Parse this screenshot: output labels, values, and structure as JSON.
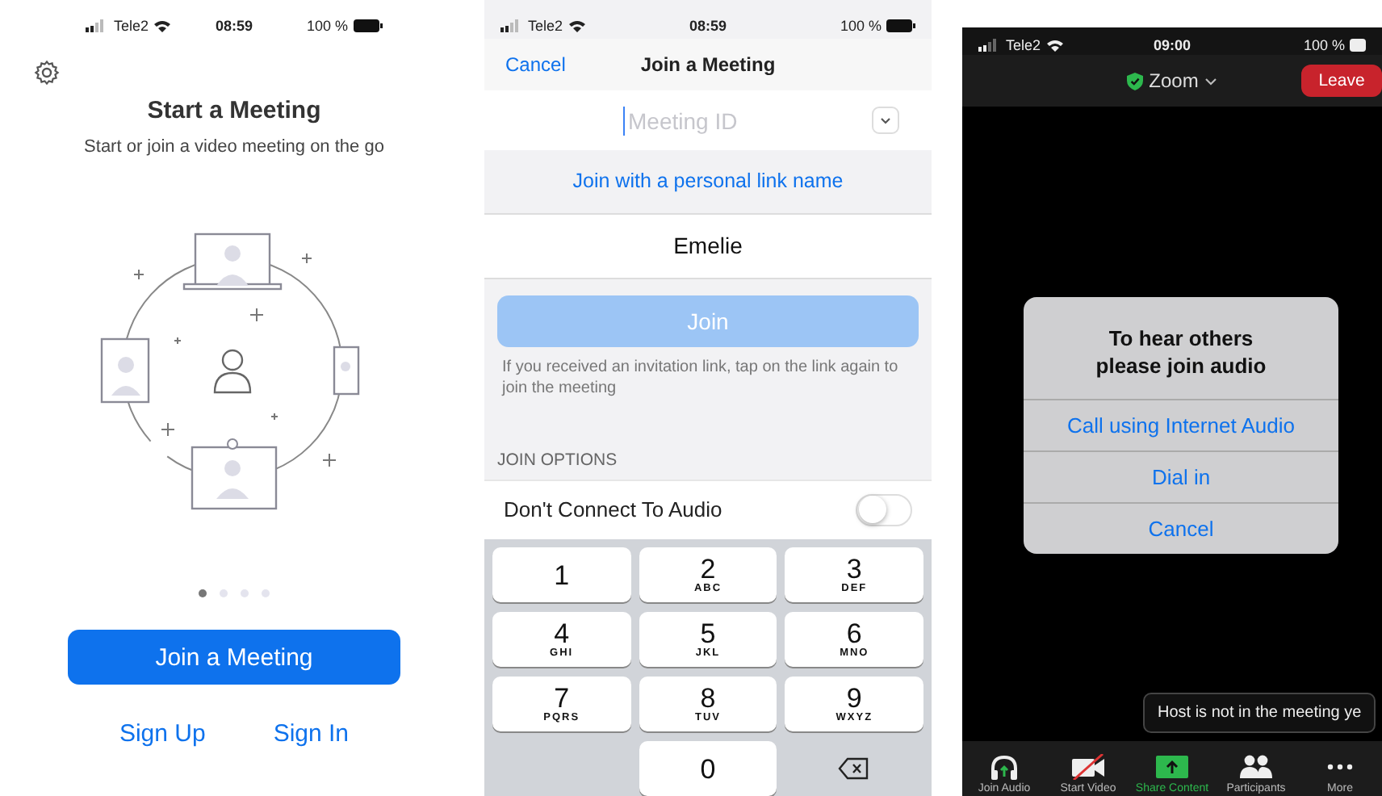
{
  "screens": [
    {
      "status_bar": {
        "carrier": "Tele2",
        "time": "08:59",
        "battery": "100 %"
      },
      "title": "Start a Meeting",
      "subtitle": "Start or join a video meeting on the go",
      "page_dots": [
        {
          "selected": true
        },
        {
          "selected": false
        },
        {
          "selected": false
        },
        {
          "selected": false
        }
      ],
      "primary_button": "Join a Meeting",
      "links": [
        "Sign Up",
        "Sign In"
      ]
    },
    {
      "status_bar": {
        "carrier": "Tele2",
        "time": "08:59",
        "battery": "100 %"
      },
      "nav": {
        "cancel": "Cancel",
        "title": "Join a Meeting"
      },
      "meeting_id": {
        "placeholder": "Meeting ID"
      },
      "personal_link": "Join with a personal link name",
      "name_field": {
        "value": "Emelie"
      },
      "join_button": {
        "label": "Join",
        "disabled": true
      },
      "hint": "If you received an invitation link, tap on the link again to join the meeting",
      "section_header": "JOIN OPTIONS",
      "options": [
        {
          "label": "Don't Connect To Audio",
          "on": false
        }
      ],
      "keypad": [
        {
          "kind": "digit",
          "digit": "1"
        },
        {
          "kind": "digit",
          "digit": "2",
          "letters": "ABC"
        },
        {
          "kind": "digit",
          "digit": "3",
          "letters": "DEF"
        },
        {
          "kind": "digit",
          "digit": "4",
          "letters": "GHI"
        },
        {
          "kind": "digit",
          "digit": "5",
          "letters": "JKL"
        },
        {
          "kind": "digit",
          "digit": "6",
          "letters": "MNO"
        },
        {
          "kind": "digit",
          "digit": "7",
          "letters": "PQRS"
        },
        {
          "kind": "digit",
          "digit": "8",
          "letters": "TUV"
        },
        {
          "kind": "digit",
          "digit": "9",
          "letters": "WXYZ"
        },
        {
          "kind": "blank"
        },
        {
          "kind": "digit",
          "digit": "0"
        },
        {
          "kind": "backspace"
        }
      ]
    },
    {
      "status_bar": {
        "carrier": "Tele2",
        "time": "09:00",
        "battery": "100 %"
      },
      "meeting_title": "Zoom",
      "leave_button": "Leave",
      "dialog": {
        "title": "To hear others please join audio",
        "options": [
          "Call using Internet Audio",
          "Dial in",
          "Cancel"
        ]
      },
      "tooltip": "Host is not in the meeting ye",
      "toolbar": [
        {
          "kind": "headphones",
          "label": "Join Audio",
          "highlighted": false
        },
        {
          "kind": "camera-off",
          "label": "Start Video",
          "highlighted": false
        },
        {
          "kind": "share",
          "label": "Share Content",
          "highlighted": true
        },
        {
          "kind": "people",
          "label": "Participants",
          "highlighted": false
        },
        {
          "kind": "more",
          "label": "More",
          "highlighted": false
        }
      ]
    }
  ]
}
